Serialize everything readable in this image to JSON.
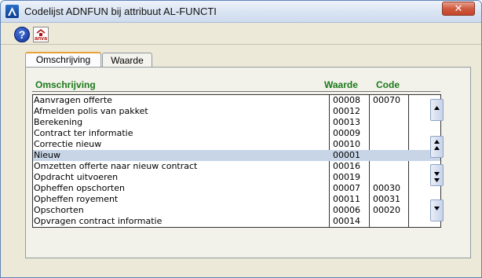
{
  "window": {
    "title": "Codelijst ADNFUN bij attribuut AL-FUNCTI",
    "close_label": "✕"
  },
  "toolbar": {
    "help_label": "?",
    "anva_label": "anva"
  },
  "tabs": [
    {
      "label": "Omschrijving",
      "active": true
    },
    {
      "label": "Waarde",
      "active": false
    }
  ],
  "grid": {
    "headers": {
      "omschrijving": "Omschrijving",
      "waarde": "Waarde",
      "code": "Code"
    },
    "rows": [
      {
        "omschrijving": "Aanvragen offerte",
        "waarde": "00008",
        "code": "00070"
      },
      {
        "omschrijving": "Afmelden polis van pakket",
        "waarde": "00012",
        "code": ""
      },
      {
        "omschrijving": "Berekening",
        "waarde": "00013",
        "code": ""
      },
      {
        "omschrijving": "Contract ter informatie",
        "waarde": "00009",
        "code": ""
      },
      {
        "omschrijving": "Correctie nieuw",
        "waarde": "00010",
        "code": ""
      },
      {
        "omschrijving": "Nieuw",
        "waarde": "00001",
        "code": ""
      },
      {
        "omschrijving": "Omzetten offerte naar nieuw contract",
        "waarde": "00016",
        "code": ""
      },
      {
        "omschrijving": "Opdracht uitvoeren",
        "waarde": "00019",
        "code": ""
      },
      {
        "omschrijving": "Opheffen opschorten",
        "waarde": "00007",
        "code": "00030"
      },
      {
        "omschrijving": "Opheffen royement",
        "waarde": "00011",
        "code": "00031"
      },
      {
        "omschrijving": "Opschorten",
        "waarde": "00006",
        "code": "00020"
      },
      {
        "omschrijving": "Opvragen contract informatie",
        "waarde": "00014",
        "code": ""
      }
    ],
    "selected_index": 5
  },
  "scroll": {
    "first_icon": "scroll-first-icon",
    "page_up_icon": "scroll-page-up-icon",
    "page_down_icon": "scroll-page-down-icon",
    "last_icon": "scroll-last-icon"
  },
  "colors": {
    "header_text": "#1b7a1b",
    "selection": "#c7d5e7",
    "active_tab_accent": "#e7a136"
  }
}
